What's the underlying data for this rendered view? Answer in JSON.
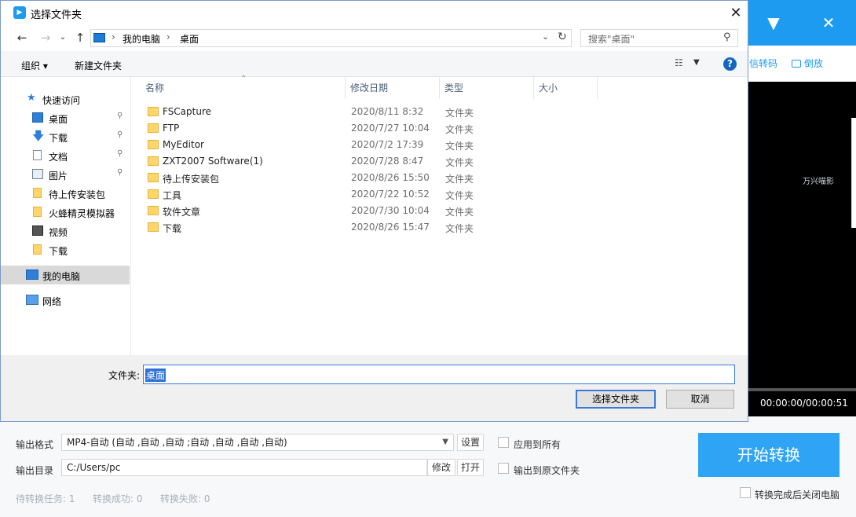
{
  "app": {
    "toolbar": {
      "tool1_label": "信转码",
      "tool2_label": "倒放"
    },
    "preview": {
      "logo_text": "万兴喵影",
      "time": "00:00:00/00:00:51"
    },
    "output": {
      "format_label": "输出格式",
      "format_value": "MP4-自动 (自动 ,自动 ,自动 ;自动 ,自动 ,自动 ,自动)",
      "settings_label": "设置",
      "apply_all_label": "应用到所有",
      "dir_label": "输出目录",
      "dir_value": "C:/Users/pc",
      "modify_label": "修改",
      "open_label": "打开",
      "to_source_label": "输出到原文件夹",
      "start_label": "开始转换",
      "shutdown_label": "转换完成后关闭电脑"
    },
    "status": {
      "pending": "待转换任务: 1",
      "success": "转换成功: 0",
      "failed": "转换失败: 0"
    }
  },
  "dialog": {
    "title": "选择文件夹",
    "address": {
      "crumbs": [
        "我的电脑",
        "桌面"
      ]
    },
    "search_placeholder": "搜索\"桌面\"",
    "commands": {
      "organize": "组织 ▾",
      "new_folder": "新建文件夹"
    },
    "nav": [
      {
        "label": "快速访问",
        "pinned": false
      },
      {
        "label": "桌面",
        "pinned": true
      },
      {
        "label": "下载",
        "pinned": true
      },
      {
        "label": "文档",
        "pinned": true
      },
      {
        "label": "图片",
        "pinned": true
      },
      {
        "label": "待上传安装包",
        "pinned": false
      },
      {
        "label": "火蜂精灵模拟器",
        "pinned": false
      },
      {
        "label": "视频",
        "pinned": false
      },
      {
        "label": "下载",
        "pinned": false
      },
      {
        "label": "我的电脑",
        "pinned": false
      },
      {
        "label": "网络",
        "pinned": false
      }
    ],
    "columns": {
      "name": "名称",
      "date": "修改日期",
      "type": "类型",
      "size": "大小"
    },
    "files": [
      {
        "name": "FSCapture",
        "date": "2020/8/11 8:32",
        "type": "文件夹"
      },
      {
        "name": "FTP",
        "date": "2020/7/27 10:04",
        "type": "文件夹"
      },
      {
        "name": "MyEditor",
        "date": "2020/7/2 17:39",
        "type": "文件夹"
      },
      {
        "name": "ZXT2007 Software(1)",
        "date": "2020/7/28 8:47",
        "type": "文件夹"
      },
      {
        "name": "待上传安装包",
        "date": "2020/8/26 15:50",
        "type": "文件夹"
      },
      {
        "name": "工具",
        "date": "2020/7/22 10:52",
        "type": "文件夹"
      },
      {
        "name": "软件文章",
        "date": "2020/7/30 10:04",
        "type": "文件夹"
      },
      {
        "name": "下载",
        "date": "2020/8/26 15:47",
        "type": "文件夹"
      }
    ],
    "folder_label": "文件夹:",
    "folder_value": "桌面",
    "select_button": "选择文件夹",
    "cancel_button": "取消"
  }
}
